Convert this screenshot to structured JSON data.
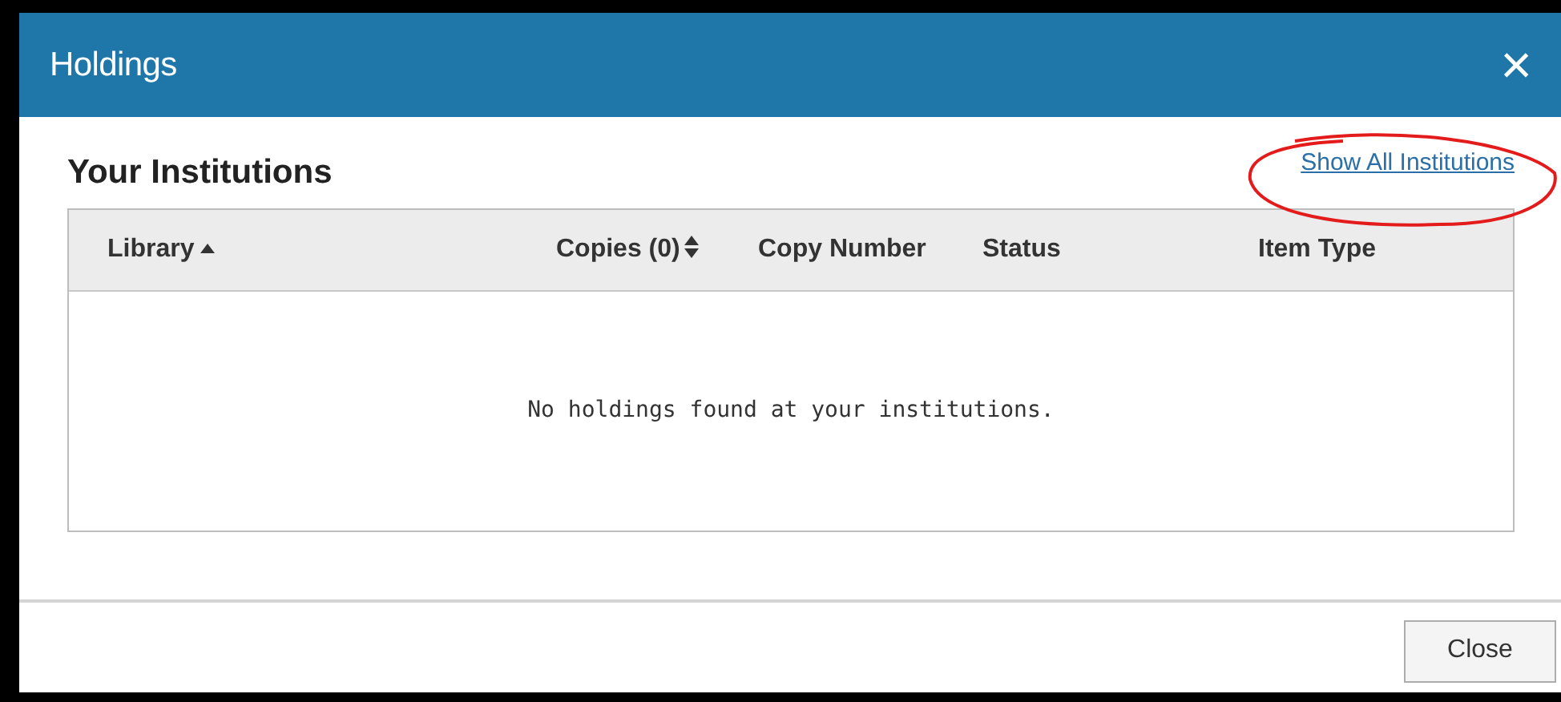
{
  "window": {
    "title": "Holdings",
    "close_icon": "×"
  },
  "section": {
    "title": "Your Institutions",
    "link": "Show All Institutions"
  },
  "table": {
    "columns": [
      {
        "label": "Library",
        "sorted": true
      },
      {
        "label": "Copies (0)",
        "sorted": false
      },
      {
        "label": "Copy Number"
      },
      {
        "label": "Status"
      },
      {
        "label": "Item Type"
      }
    ],
    "empty_message": "No holdings found at your institutions."
  },
  "buttons": [
    "Close"
  ]
}
